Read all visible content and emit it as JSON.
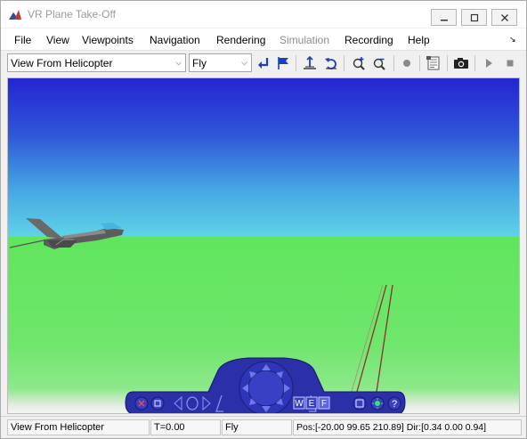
{
  "window": {
    "title": "VR Plane Take-Off",
    "icon": "matlab-icon"
  },
  "menu": {
    "items": [
      "File",
      "View",
      "Viewpoints",
      "Navigation",
      "Rendering",
      "Simulation",
      "Recording",
      "Help"
    ],
    "disabled": [
      "Simulation"
    ]
  },
  "toolbar": {
    "viewpoint_select": "View From Helicopter",
    "navigation_select": "Fly",
    "icons": [
      "return-to-viewpoint-icon",
      "create-viewpoint-icon",
      "straighten-up-icon",
      "undo-move-icon",
      "zoom-in-icon",
      "zoom-out-icon",
      "record-icon",
      "capture-frame-icon",
      "snapshot-camera-icon",
      "play-icon",
      "stop-icon"
    ]
  },
  "navpanel": {
    "labels": {
      "w": "W",
      "e": "E",
      "f": "F",
      "help": "?"
    }
  },
  "status": {
    "viewpoint": "View From Helicopter",
    "time": "T=0.00",
    "nav_mode": "Fly",
    "position": "Pos:[-20.00 99.65 210.89] Dir:[0.34 0.00 0.94]"
  },
  "colors": {
    "sky_top": "#2525d2",
    "sky_horizon": "#5fd3e6",
    "ground": "#61e55d",
    "nav_panel": "#2b2fa8"
  }
}
